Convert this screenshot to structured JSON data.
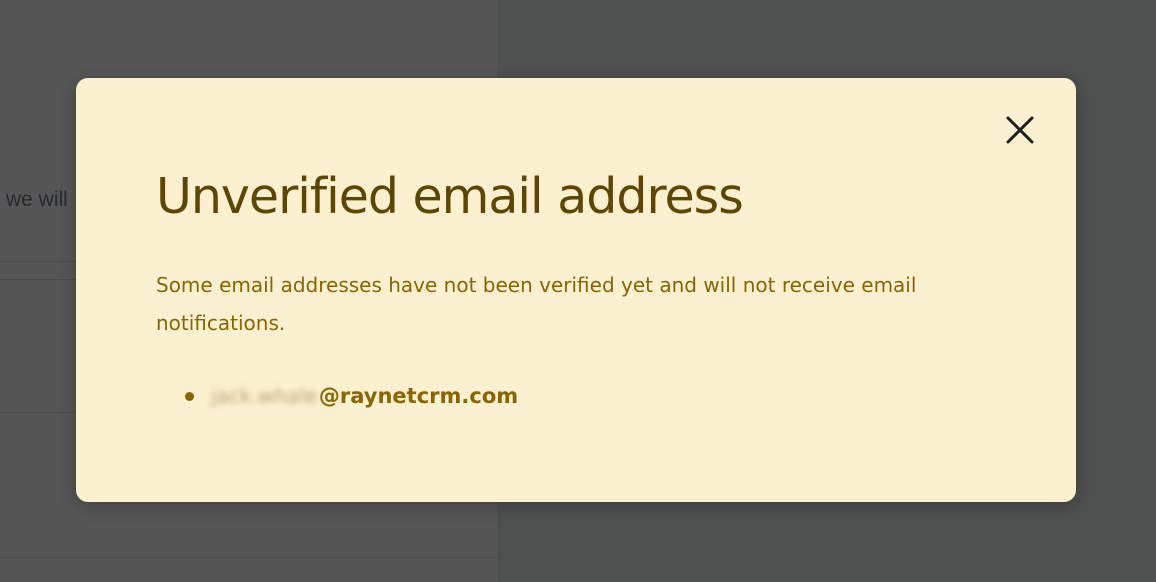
{
  "background": {
    "snippet_text": "we will"
  },
  "modal": {
    "title": "Unverified email address",
    "description": "Some email addresses have not been verified yet and will not receive email notifications.",
    "close_icon": "close-icon",
    "emails": [
      {
        "local_part": "jack.whale",
        "domain": "@raynetcrm.com"
      }
    ]
  },
  "colors": {
    "modal_background": "#fbf0cf",
    "title_text": "#5f4600",
    "body_text": "#8a6400",
    "overlay": "#4f5151"
  }
}
